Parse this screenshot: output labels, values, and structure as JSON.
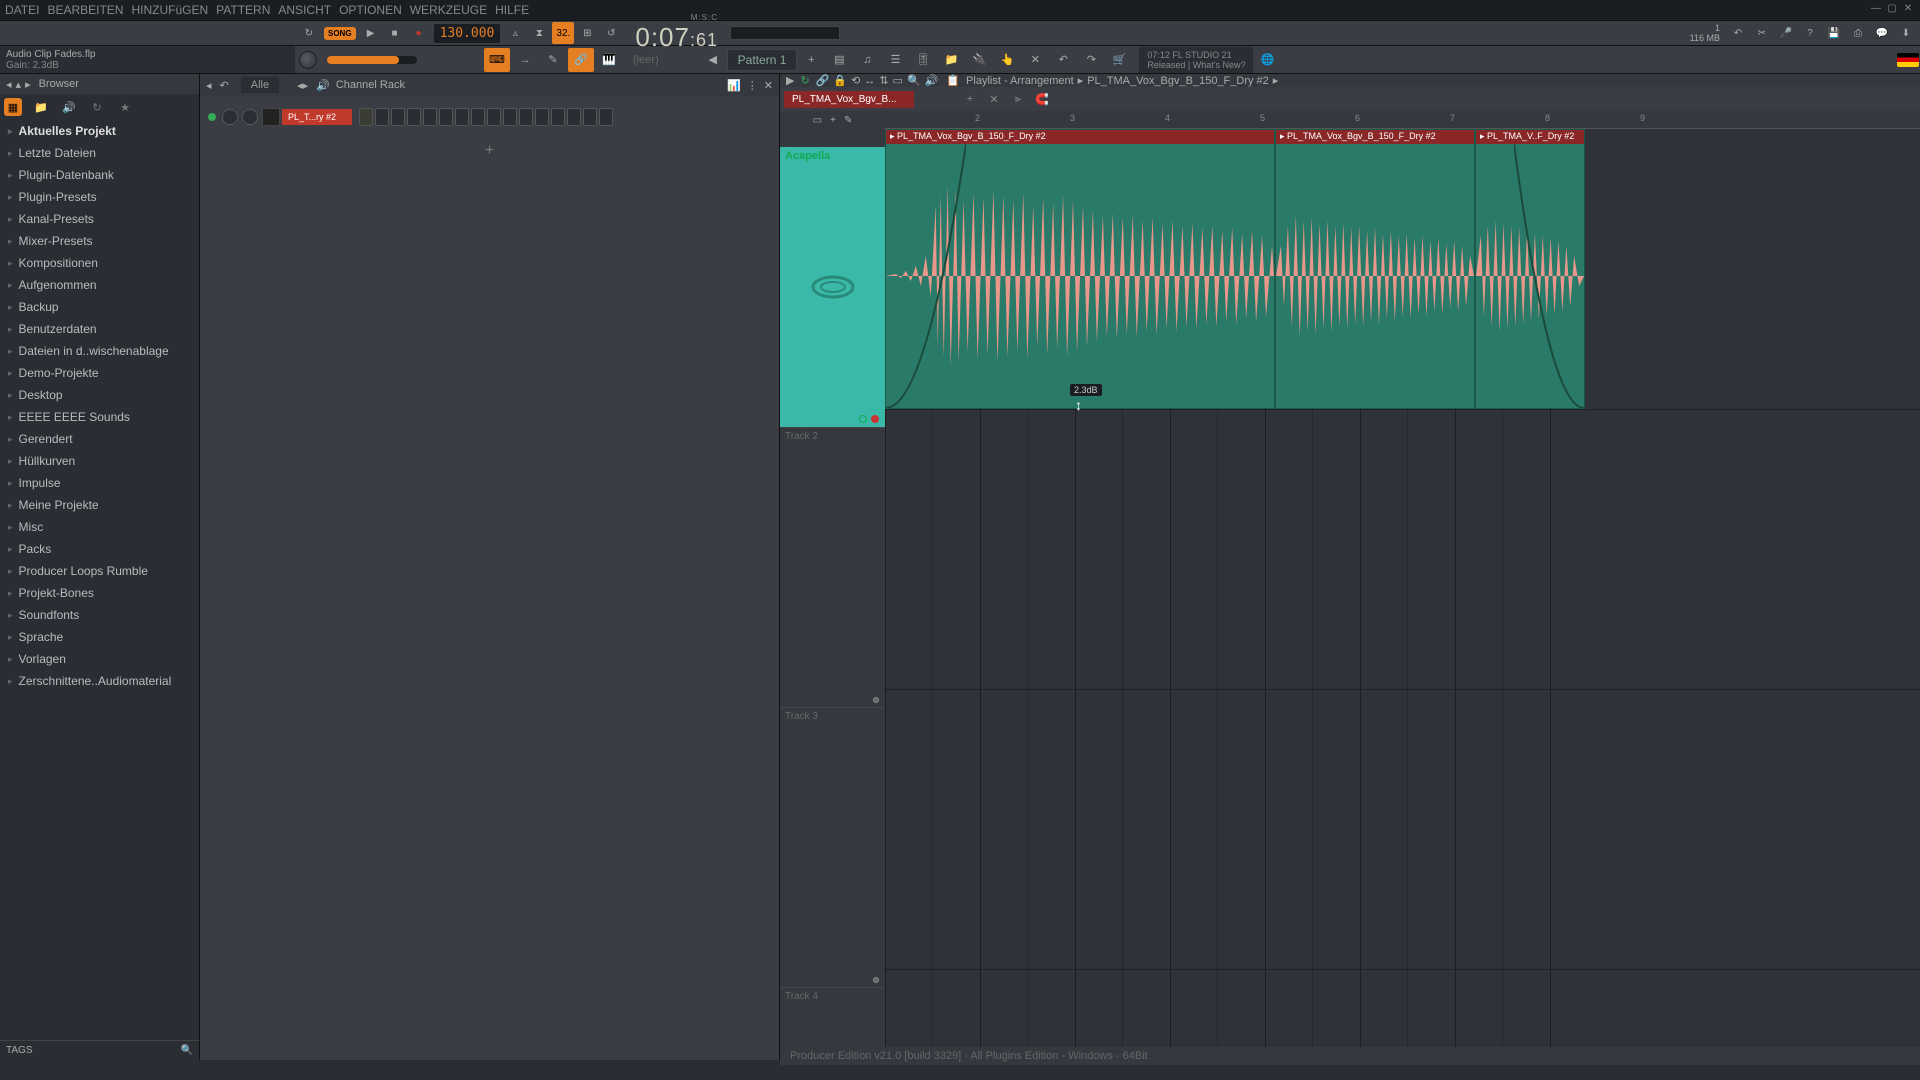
{
  "menu": [
    "DATEI",
    "BEARBEITEN",
    "HINZUFüGEN",
    "PATTERN",
    "ANSICHT",
    "OPTIONEN",
    "WERKZEUGE",
    "HILFE"
  ],
  "hint": {
    "title": "Audio Clip Fades.flp",
    "value": "Gain:   2.3dB"
  },
  "transport": {
    "song": "SONG",
    "tempo": "130.000",
    "time_min": "0:07",
    "time_dec": ":61",
    "time_label": "M:S:C"
  },
  "snap": "32.",
  "mem": {
    "line1": "1",
    "line2": "116 MB"
  },
  "pattern": "Pattern 1",
  "leer": "(leer)",
  "news": {
    "line1": "07:12   FL STUDIO 21",
    "line2": "Released | What's New?"
  },
  "browser": {
    "title": "Browser",
    "items": [
      {
        "label": "Aktuelles Projekt",
        "bold": true
      },
      {
        "label": "Letzte Dateien"
      },
      {
        "label": "Plugin-Datenbank"
      },
      {
        "label": "Plugin-Presets"
      },
      {
        "label": "Kanal-Presets"
      },
      {
        "label": "Mixer-Presets"
      },
      {
        "label": "Kompositionen"
      },
      {
        "label": "Aufgenommen"
      },
      {
        "label": "Backup"
      },
      {
        "label": "Benutzerdaten"
      },
      {
        "label": "Dateien in d..wischenablage"
      },
      {
        "label": "Demo-Projekte"
      },
      {
        "label": "Desktop"
      },
      {
        "label": "EEEE EEEE Sounds"
      },
      {
        "label": "Gerendert"
      },
      {
        "label": "Hüllkurven"
      },
      {
        "label": "Impulse"
      },
      {
        "label": "Meine Projekte"
      },
      {
        "label": "Misc"
      },
      {
        "label": "Packs"
      },
      {
        "label": "Producer Loops Rumble"
      },
      {
        "label": "Projekt-Bones"
      },
      {
        "label": "Soundfonts"
      },
      {
        "label": "Sprache"
      },
      {
        "label": "Vorlagen"
      },
      {
        "label": "Zerschnittene..Audiomaterial"
      }
    ],
    "tags": "TAGS"
  },
  "channelrack": {
    "title": "Channel Rack",
    "filter": "Alle",
    "channel": "PL_T...ry #2"
  },
  "playlist": {
    "title": "Playlist - Arrangement",
    "breadcrumb": "PL_TMA_Vox_Bgv_B_150_F_Dry #2",
    "clip_sel": "PL_TMA_Vox_Bgv_B...",
    "track1": "Acapella",
    "track2": "Track 2",
    "track3": "Track 3",
    "track4": "Track 4",
    "clip1_title": "▸ PL_TMA_Vox_Bgv_B_150_F_Dry #2",
    "clip2_title": "▸ PL_TMA_Vox_Bgv_B_150_F_Dry #2",
    "clip3_title": "▸ PL_TMA_V..F_Dry #2",
    "gain_label": "2.3dB",
    "ruler": [
      "2",
      "3",
      "4",
      "5",
      "6",
      "7",
      "8",
      "9"
    ]
  },
  "status": "Producer Edition v21.0 [build 3329] - All Plugins Edition - Windows - 64Bit"
}
